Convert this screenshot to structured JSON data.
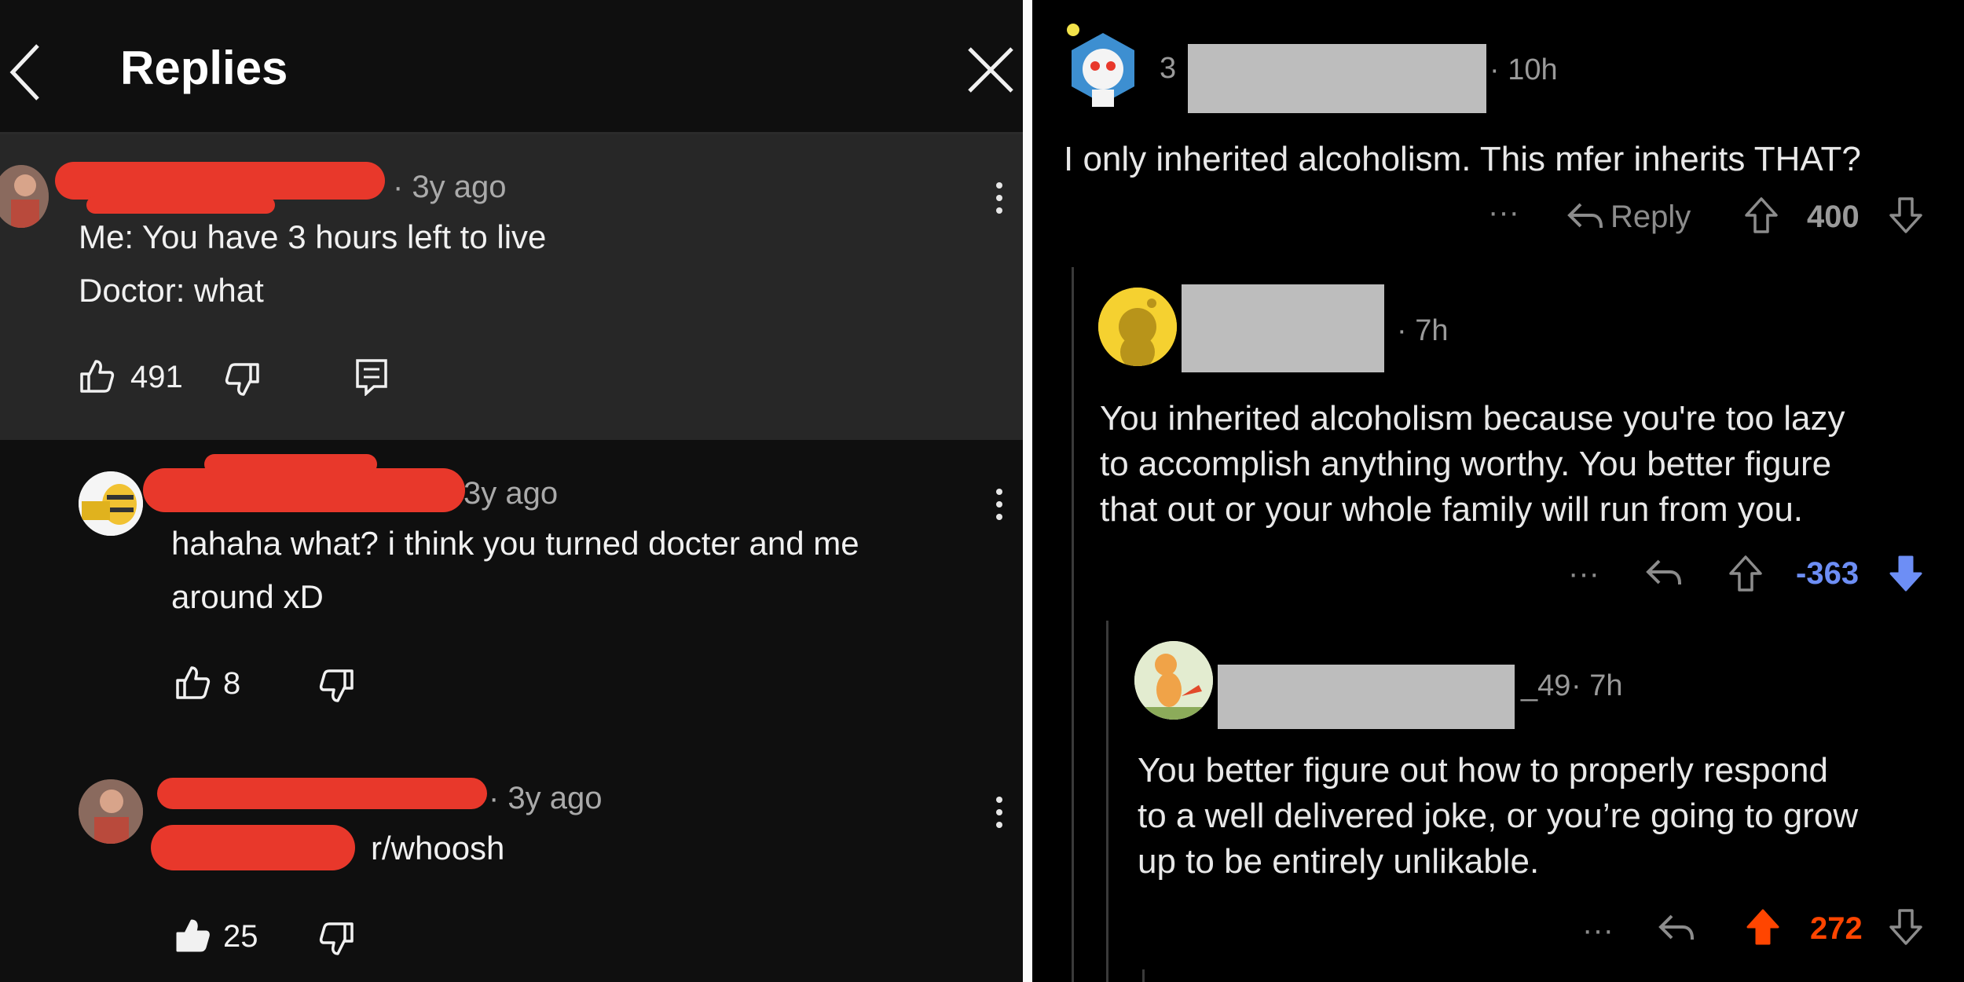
{
  "left": {
    "header": {
      "title": "Replies"
    },
    "comments": [
      {
        "meta": "· 3y ago",
        "lines": [
          "Me: You have 3 hours left to live",
          "Doctor: what"
        ],
        "likes": "491"
      },
      {
        "meta": "3y ago",
        "lines": [
          "hahaha what? i think you turned docter and me",
          "around xD"
        ],
        "likes": "8"
      },
      {
        "meta": "· 3y ago",
        "text": "r/whoosh",
        "likes": "25"
      }
    ]
  },
  "right": {
    "comments": [
      {
        "username_fragment": "3",
        "time": "· 10h",
        "text": "I only inherited alcoholism. This mfer inherits THAT?",
        "actions": {
          "more": "···",
          "reply": "Reply"
        },
        "score": "400"
      },
      {
        "time": "· 7h",
        "lines": [
          "You inherited alcoholism because you're too lazy",
          "to accomplish anything worthy. You better figure",
          "that out or your whole family will run from you."
        ],
        "actions": {
          "more": "···"
        },
        "score": "-363"
      },
      {
        "username_fragment": "_49",
        "time": "· 7h",
        "lines": [
          "You better figure out how to properly respond",
          "to a well delivered joke, or you’re going to grow",
          "up to be entirely unlikable."
        ],
        "actions": {
          "more": "···"
        },
        "score": "272"
      }
    ],
    "colors": {
      "downvote": "#6d8ef5",
      "upvote": "#ff4500"
    }
  }
}
